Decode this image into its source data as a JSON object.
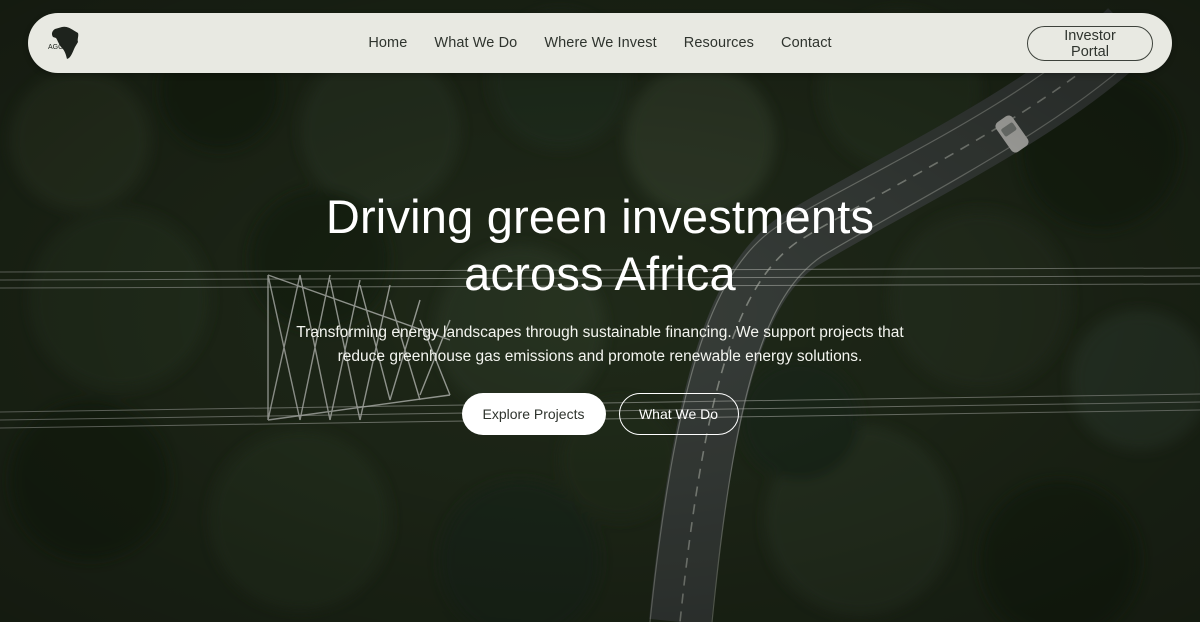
{
  "logo": {
    "text": "AGG",
    "icon": "africa-map-icon"
  },
  "nav": {
    "items": [
      {
        "label": "Home"
      },
      {
        "label": "What We Do"
      },
      {
        "label": "Where We Invest"
      },
      {
        "label": "Resources"
      },
      {
        "label": "Contact"
      }
    ],
    "portal_label": "Investor Portal"
  },
  "hero": {
    "headline_line1": "Driving green investments",
    "headline_line2": "across Africa",
    "subtitle_line1": "Transforming energy landscapes through sustainable financing. We support projects that",
    "subtitle_line2": "reduce greenhouse gas emissions and promote renewable energy solutions.",
    "primary_cta": "Explore Projects",
    "secondary_cta": "What We Do"
  },
  "colors": {
    "nav_bg": "#e8e9e2",
    "text_dark": "#2f342e",
    "forest": "#2a3626",
    "road": "#3e4541"
  }
}
